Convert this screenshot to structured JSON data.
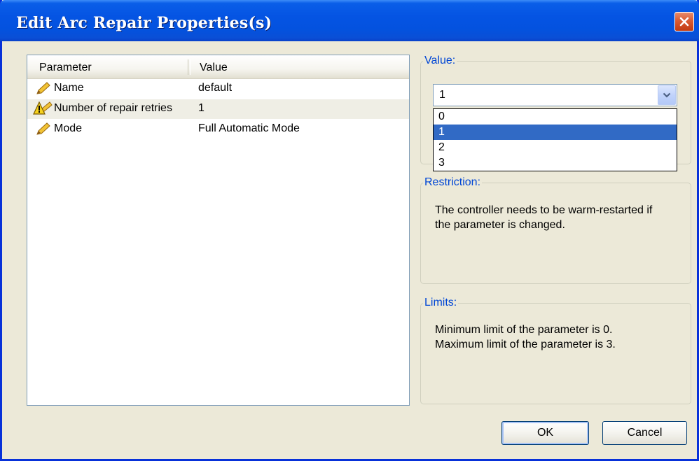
{
  "window": {
    "title": "Edit Arc Repair Properties(s)"
  },
  "list": {
    "columns": [
      "Parameter",
      "Value"
    ],
    "rows": [
      {
        "icon": "pencil-icon",
        "name": "Name",
        "value": "default"
      },
      {
        "icon": "warning-pencil-icon",
        "name": "Number of repair retries",
        "value": "1"
      },
      {
        "icon": "pencil-icon",
        "name": "Mode",
        "value": "Full Automatic Mode"
      }
    ]
  },
  "value_group": {
    "label": "Value:",
    "combo_value": "1",
    "options": [
      "0",
      "1",
      "2",
      "3"
    ],
    "selected_option": "1"
  },
  "restriction_group": {
    "label": "Restriction:",
    "lines": [
      "The controller needs to be warm-restarted if",
      "the parameter is changed."
    ]
  },
  "limits_group": {
    "label": "Limits:",
    "lines": [
      "Minimum limit of the parameter is 0.",
      "Maximum limit of the parameter is 3."
    ]
  },
  "buttons": {
    "ok": "OK",
    "cancel": "Cancel"
  },
  "colors": {
    "titlebar": "#0554e3",
    "selection": "#316ac5",
    "group_label": "#0046d5",
    "dialog_bg": "#ece9d8"
  }
}
